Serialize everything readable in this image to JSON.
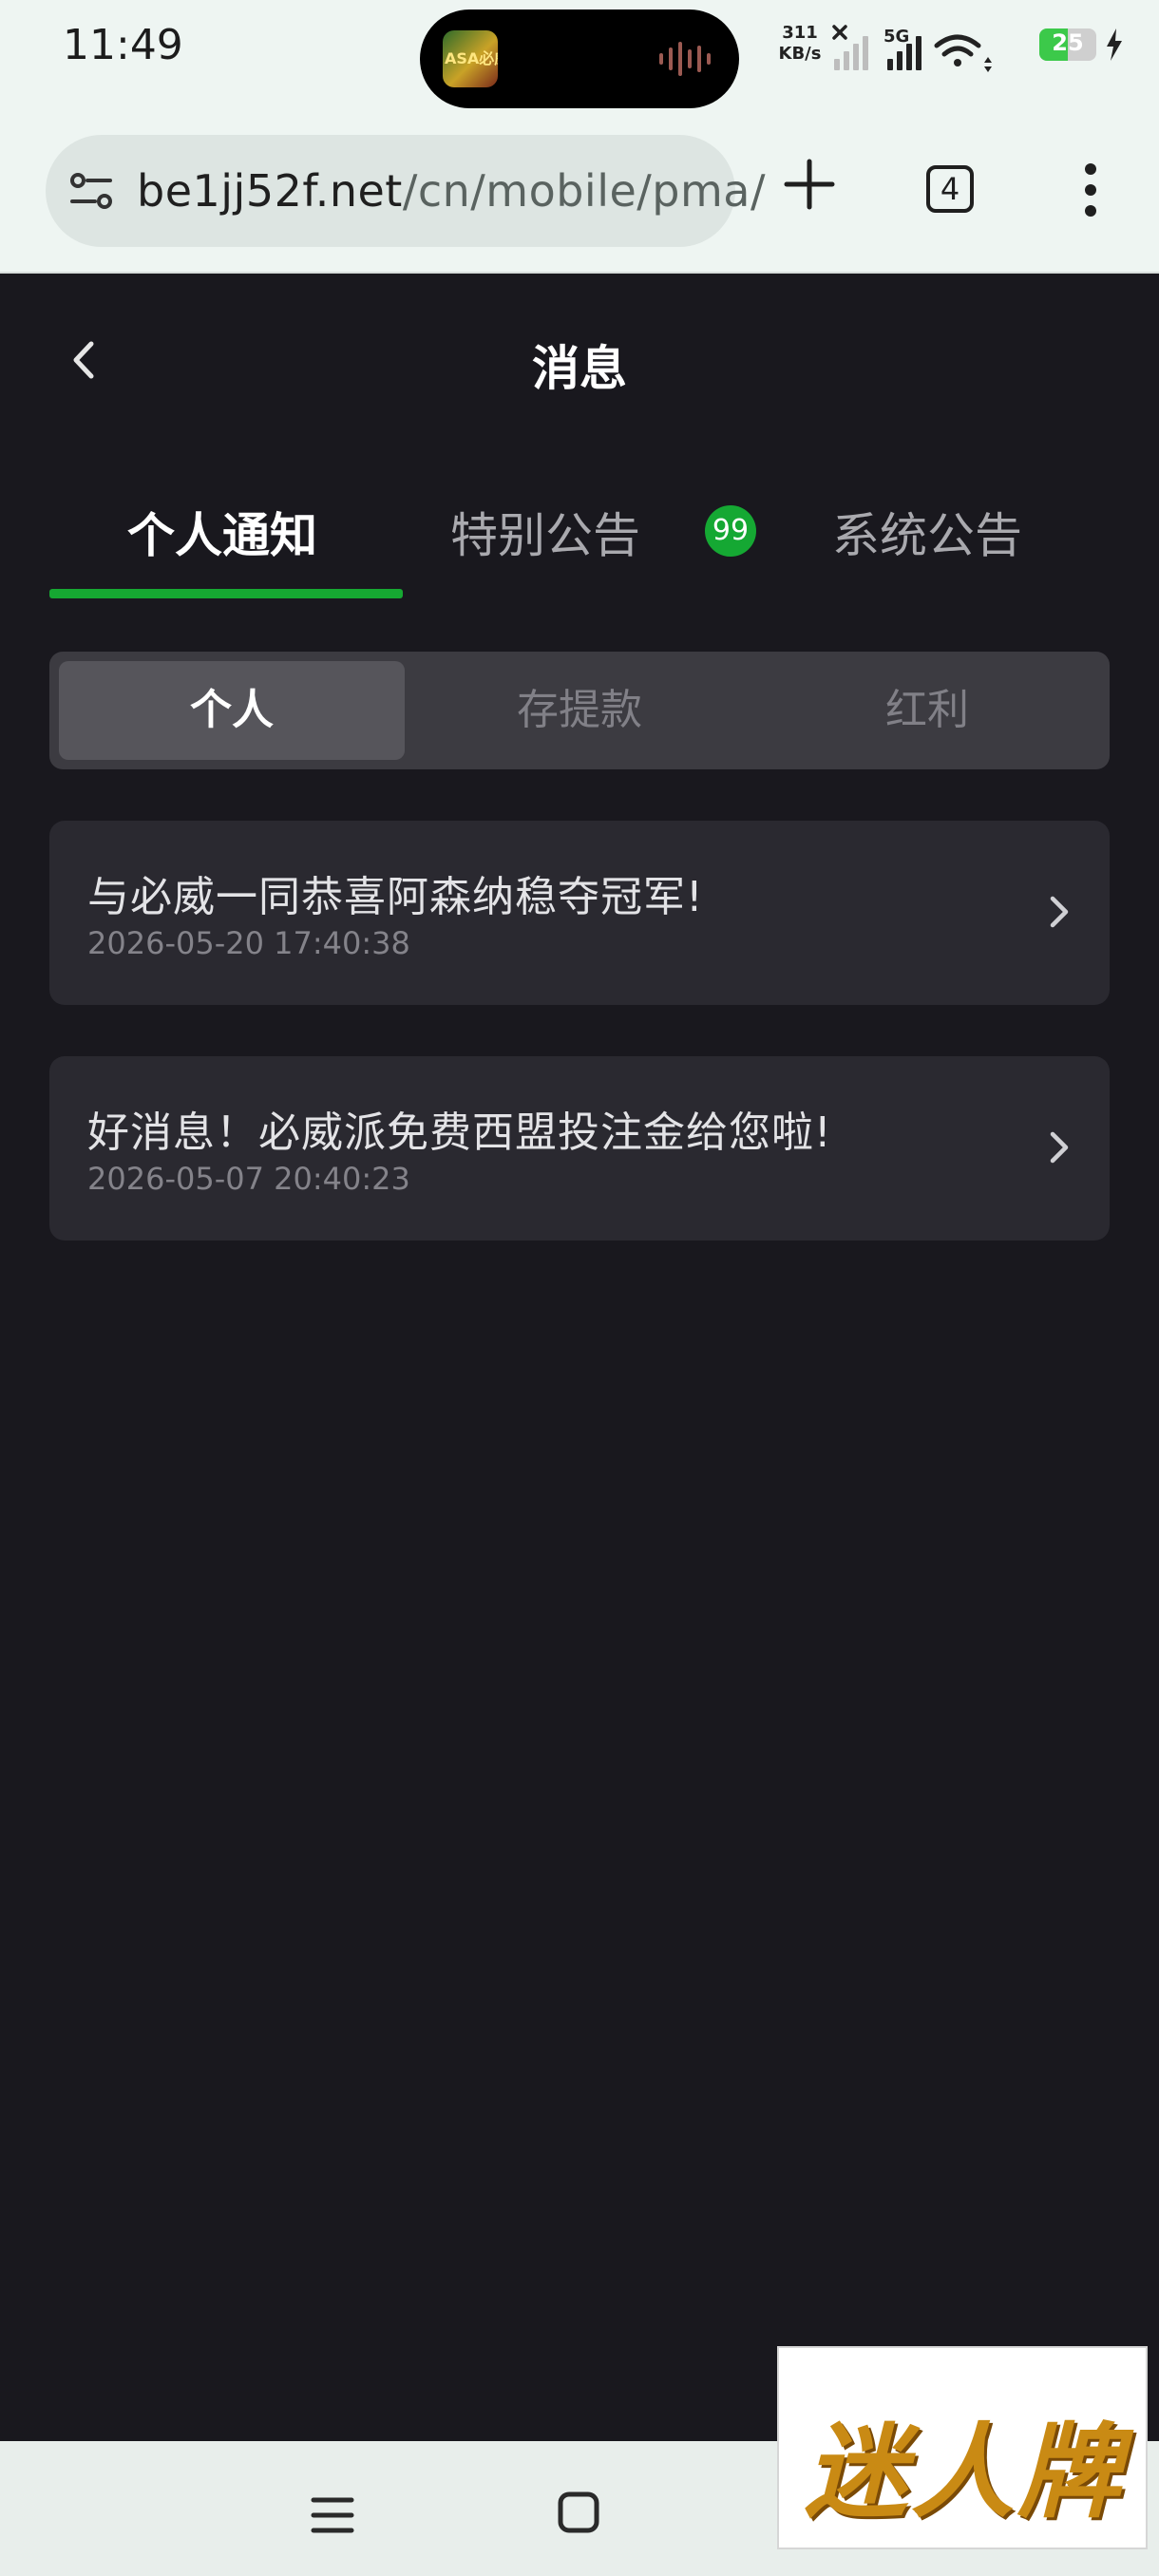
{
  "status_bar": {
    "time": "11:49",
    "net_speed_value": "311",
    "net_speed_unit": "KB/s",
    "network_type": "5G",
    "battery_level": "25",
    "island_thumb_text": "ASA必威"
  },
  "browser": {
    "url_domain": "be1jj52f.net",
    "url_path": "/cn/mobile/pma/",
    "tab_count": "4"
  },
  "page": {
    "title": "消息"
  },
  "tabs": [
    {
      "label": "个人通知",
      "active": true
    },
    {
      "label": "特别公告",
      "active": false,
      "badge": "99"
    },
    {
      "label": "系统公告",
      "active": false
    }
  ],
  "segments": [
    {
      "label": "个人",
      "active": true
    },
    {
      "label": "存提款",
      "active": false
    },
    {
      "label": "红利",
      "active": false
    }
  ],
  "messages": [
    {
      "title": "与必威一同恭喜阿森纳稳夺冠军!",
      "date": "2026-05-20 17:40:38"
    },
    {
      "title": "好消息！必威派免费西盟投注金给您啦!",
      "date": "2026-05-07 20:40:23"
    }
  ],
  "overlay_logo": {
    "text": "迷人牌"
  },
  "colors": {
    "background": "#19181e",
    "accent_green": "#16a832",
    "card": "#2a2930",
    "segment_bg": "#3c3b41"
  }
}
